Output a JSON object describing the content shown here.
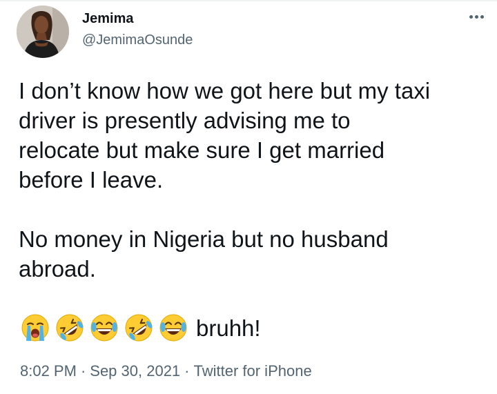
{
  "author": {
    "display_name": "Jemima",
    "handle": "@JemimaOsunde"
  },
  "tweet": {
    "text": "I don’t know how we got here but my taxi\ndriver is presently advising me to\nrelocate but make sure I get married\nbefore I leave.\n\nNo money in Nigeria but no husband\nabroad.",
    "emojis": [
      "loudly-crying-face",
      "rolling-on-the-floor-laughing",
      "face-with-tears-of-joy",
      "rolling-on-the-floor-laughing",
      "face-with-tears-of-joy"
    ],
    "emoji_suffix": "bruhh!"
  },
  "meta": {
    "time": "8:02 PM",
    "separator": "·",
    "date": "Sep 30, 2021",
    "source": "Twitter for iPhone"
  },
  "icons": {
    "more": "more-horizontal-icon"
  },
  "colors": {
    "text_primary": "#0f1419",
    "text_secondary": "#536471",
    "emoji_yellow": "#ffcc33",
    "emoji_tear": "#4fb3ea"
  }
}
